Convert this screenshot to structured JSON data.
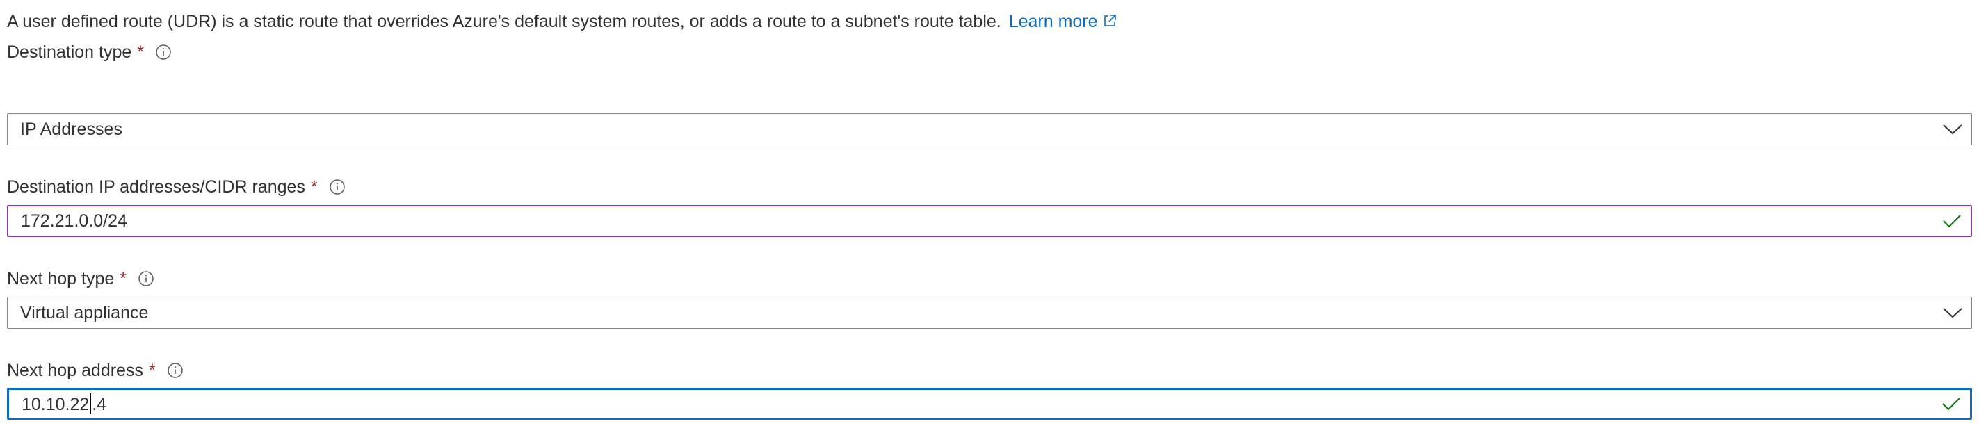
{
  "intro": {
    "text": "A user defined route (UDR) is a static route that overrides Azure's default system routes, or adds a route to a subnet's route table.",
    "link_label": "Learn more"
  },
  "fields": {
    "destination_type": {
      "label": "Destination type",
      "required_marker": "*",
      "value": "IP Addresses"
    },
    "destination_ranges": {
      "label": "Destination IP addresses/CIDR ranges",
      "required_marker": "*",
      "value": "172.21.0.0/24"
    },
    "next_hop_type": {
      "label": "Next hop type",
      "required_marker": "*",
      "value": "Virtual appliance"
    },
    "next_hop_address": {
      "label": "Next hop address",
      "required_marker": "*",
      "value_before_caret": "10.10.22",
      "value_after_caret": ".4"
    }
  },
  "icons": {
    "info": "info-icon",
    "dropdown": "chevron-down-icon",
    "valid": "checkmark-icon",
    "external": "external-link-icon"
  },
  "colors": {
    "link": "#0f6cbd",
    "required": "#a4262c",
    "valid_check": "#107c10",
    "valid_border": "#8a3fa0",
    "focus_border": "#0f6cbd"
  }
}
